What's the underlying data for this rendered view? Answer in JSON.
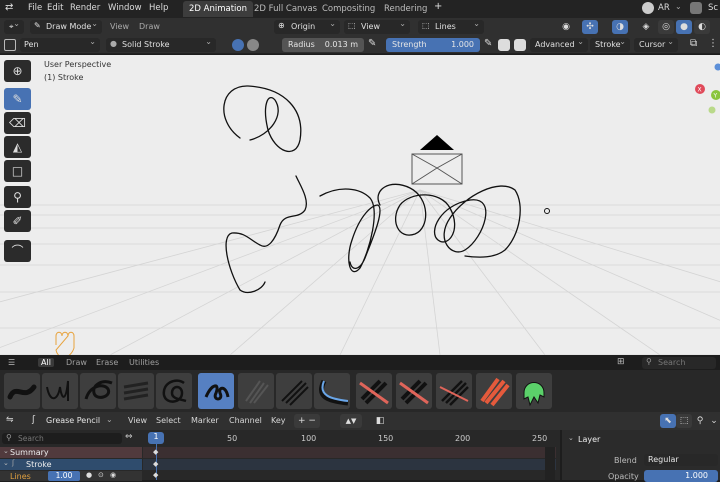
{
  "topbar": {
    "menus": [
      "File",
      "Edit",
      "Render",
      "Window",
      "Help"
    ],
    "workspaces": [
      "2D Animation",
      "2D Full Canvas",
      "Compositing",
      "Rendering"
    ],
    "add_workspace": "+",
    "right_label": "AR",
    "right_cut": "Sc"
  },
  "header": {
    "mode": "Draw Mode",
    "view": "View",
    "draw": "Draw",
    "origin": "Origin",
    "view2": "View",
    "lines": "Lines"
  },
  "toolsettings": {
    "brush": "Pen",
    "stroke_type": "Solid Stroke",
    "radius_label": "Radius",
    "radius_value": "0.013 m",
    "strength_label": "Strength",
    "strength_value": "1.000",
    "advanced": "Advanced",
    "stroke": "Stroke",
    "cursor": "Cursor"
  },
  "viewport": {
    "perspective": "User Perspective",
    "object_info": "(1) Stroke",
    "gizmo_x": "X",
    "gizmo_y": "Y"
  },
  "brush_tabs": [
    "All",
    "Draw",
    "Erase",
    "Utilities"
  ],
  "brush_search_placeholder": "Search",
  "timeline_header": {
    "mode": "Grease Pencil",
    "menus": [
      "View",
      "Select",
      "Marker",
      "Channel",
      "Key"
    ]
  },
  "timeline": {
    "search_placeholder": "Search",
    "current_frame": "1",
    "ticks": [
      "50",
      "100",
      "150",
      "200",
      "250"
    ],
    "channels": [
      "Summary",
      "Stroke",
      "Lines"
    ],
    "lines_value": "1.00"
  },
  "layer_panel": {
    "title": "Layer",
    "blend_label": "Blend",
    "blend_value": "Regular",
    "opacity_label": "Opacity",
    "opacity_value": "1.000"
  },
  "colors": {
    "accent": "#4772b3",
    "viewport_bg": "#ededed",
    "panel_bg": "#303030"
  }
}
